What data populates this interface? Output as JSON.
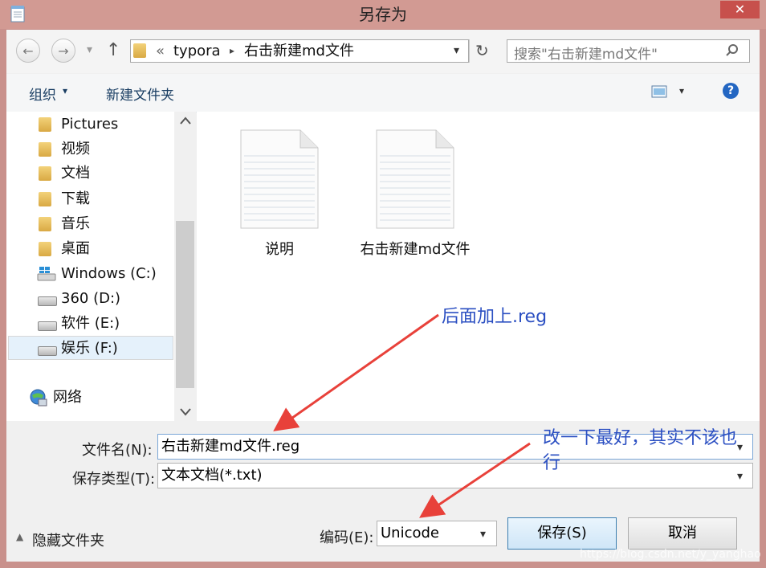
{
  "window": {
    "title": "另存为",
    "close_glyph": "✕"
  },
  "nav": {
    "back_glyph": "←",
    "forward_glyph": "→",
    "dropdown_glyph": "▾",
    "up_glyph": "↑",
    "address_overflow": "«",
    "address_path": [
      "typora",
      "右击新建md文件"
    ],
    "separator": "▸",
    "refresh_glyph": "↻",
    "search_placeholder": "搜索\"右击新建md文件\""
  },
  "toolbar": {
    "organize": "组织",
    "organize_caret": "▾",
    "new_folder": "新建文件夹",
    "view_caret": "▾",
    "help_glyph": "?"
  },
  "sidebar": {
    "items": [
      {
        "label": "Pictures",
        "icon": "pictures-folder-icon"
      },
      {
        "label": "视频",
        "icon": "videos-folder-icon"
      },
      {
        "label": "文档",
        "icon": "documents-folder-icon"
      },
      {
        "label": "下载",
        "icon": "downloads-folder-icon"
      },
      {
        "label": "音乐",
        "icon": "music-folder-icon"
      },
      {
        "label": "桌面",
        "icon": "desktop-folder-icon"
      },
      {
        "label": "Windows (C:)",
        "icon": "windows-drive-icon"
      },
      {
        "label": "360 (D:)",
        "icon": "drive-icon"
      },
      {
        "label": "软件 (E:)",
        "icon": "drive-icon"
      },
      {
        "label": "娱乐 (F:)",
        "icon": "drive-icon",
        "selected": true
      }
    ],
    "network": "网络"
  },
  "files": [
    {
      "name": "说明",
      "icon": "text-file-icon"
    },
    {
      "name": "右击新建md文件",
      "icon": "text-file-icon"
    }
  ],
  "annotations": {
    "note1": "后面加上.reg",
    "note2_line1": "改一下最好，其实不该也",
    "note2_line2": "行",
    "arrow_color": "#e8413a"
  },
  "form": {
    "filename_label": "文件名(N):",
    "filename_value": "右击新建md文件.reg",
    "type_label": "保存类型(T):",
    "type_value": "文本文档(*.txt)",
    "encoding_label": "编码(E):",
    "encoding_value": "Unicode",
    "hide_folders": "隐藏文件夹",
    "hide_glyph": "▲",
    "save": "保存(S)",
    "cancel": "取消"
  },
  "watermark": "https://blog.csdn.net/y_yanghao"
}
